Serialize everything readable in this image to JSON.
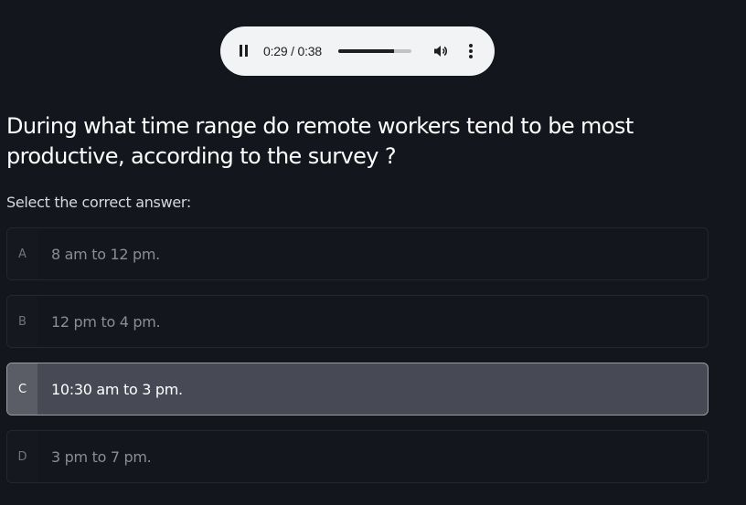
{
  "player": {
    "time_display": "0:29 / 0:38",
    "progress_fraction": 0.763,
    "icons": [
      "pause-icon",
      "volume-icon",
      "more-options-icon"
    ]
  },
  "question": {
    "text": "During what time range do remote workers tend to be most productive, according to the survey ?",
    "instruction": "Select the correct answer:"
  },
  "options": [
    {
      "letter": "A",
      "text": "8 am to 12 pm."
    },
    {
      "letter": "B",
      "text": "12 pm to 4 pm."
    },
    {
      "letter": "C",
      "text": "10:30 am to 3 pm."
    },
    {
      "letter": "D",
      "text": "3 pm to 7 pm."
    }
  ],
  "selected_option": "C",
  "colors": {
    "background": "#13161d",
    "selected_background": "#474a54",
    "player_background": "#f1f3f4"
  }
}
